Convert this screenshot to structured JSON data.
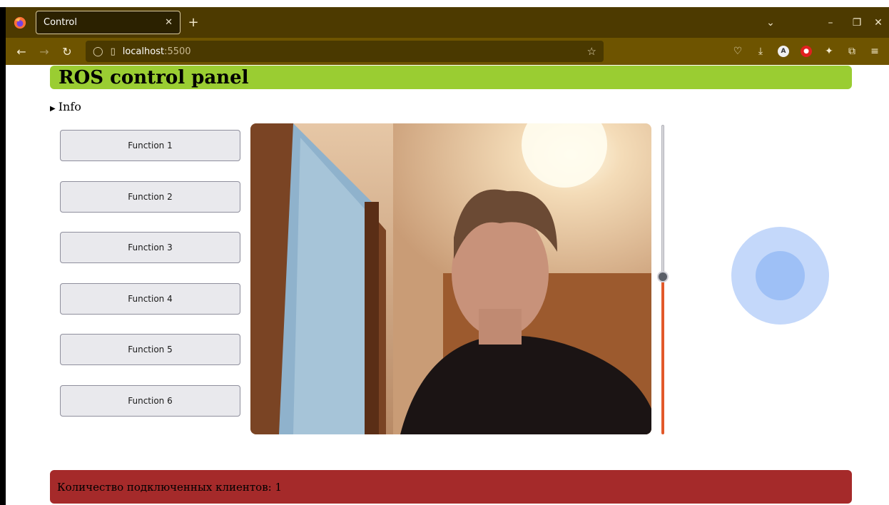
{
  "browser": {
    "tab_title": "Control",
    "tab_close": "✕",
    "new_tab": "+",
    "url_host": "localhost",
    "url_port": ":5500",
    "window_controls": {
      "minimize": "–",
      "restore": "❐",
      "close": "✕",
      "list_tabs": "⌄"
    }
  },
  "page": {
    "title": "ROS control panel",
    "info_label": "Info",
    "functions": [
      {
        "label": "Function 1"
      },
      {
        "label": "Function 2"
      },
      {
        "label": "Function 3"
      },
      {
        "label": "Function 4"
      },
      {
        "label": "Function 5"
      },
      {
        "label": "Function 6"
      }
    ],
    "slider": {
      "value_fraction": 0.5
    },
    "footer_text": "Количество подключенных клиентов: 1"
  },
  "colors": {
    "header_bg": "#9acd32",
    "footer_bg": "#a52a2a",
    "slider_fill": "#e2592a",
    "joystick_outer": "#c4d8fa",
    "joystick_inner": "#9ec0f6",
    "chrome_tabbar": "#4d3a00",
    "chrome_navbar": "#6e5400"
  },
  "icons": {
    "browser_logo": "firefox-icon",
    "back": "arrow-left-icon",
    "forward": "arrow-right-icon",
    "reload": "reload-icon",
    "shield": "shield-icon",
    "page": "page-icon",
    "bookmark": "star-icon",
    "pocket": "pocket-icon",
    "download": "download-icon",
    "extensions": "puzzle-icon",
    "menu": "hamburger-icon"
  }
}
